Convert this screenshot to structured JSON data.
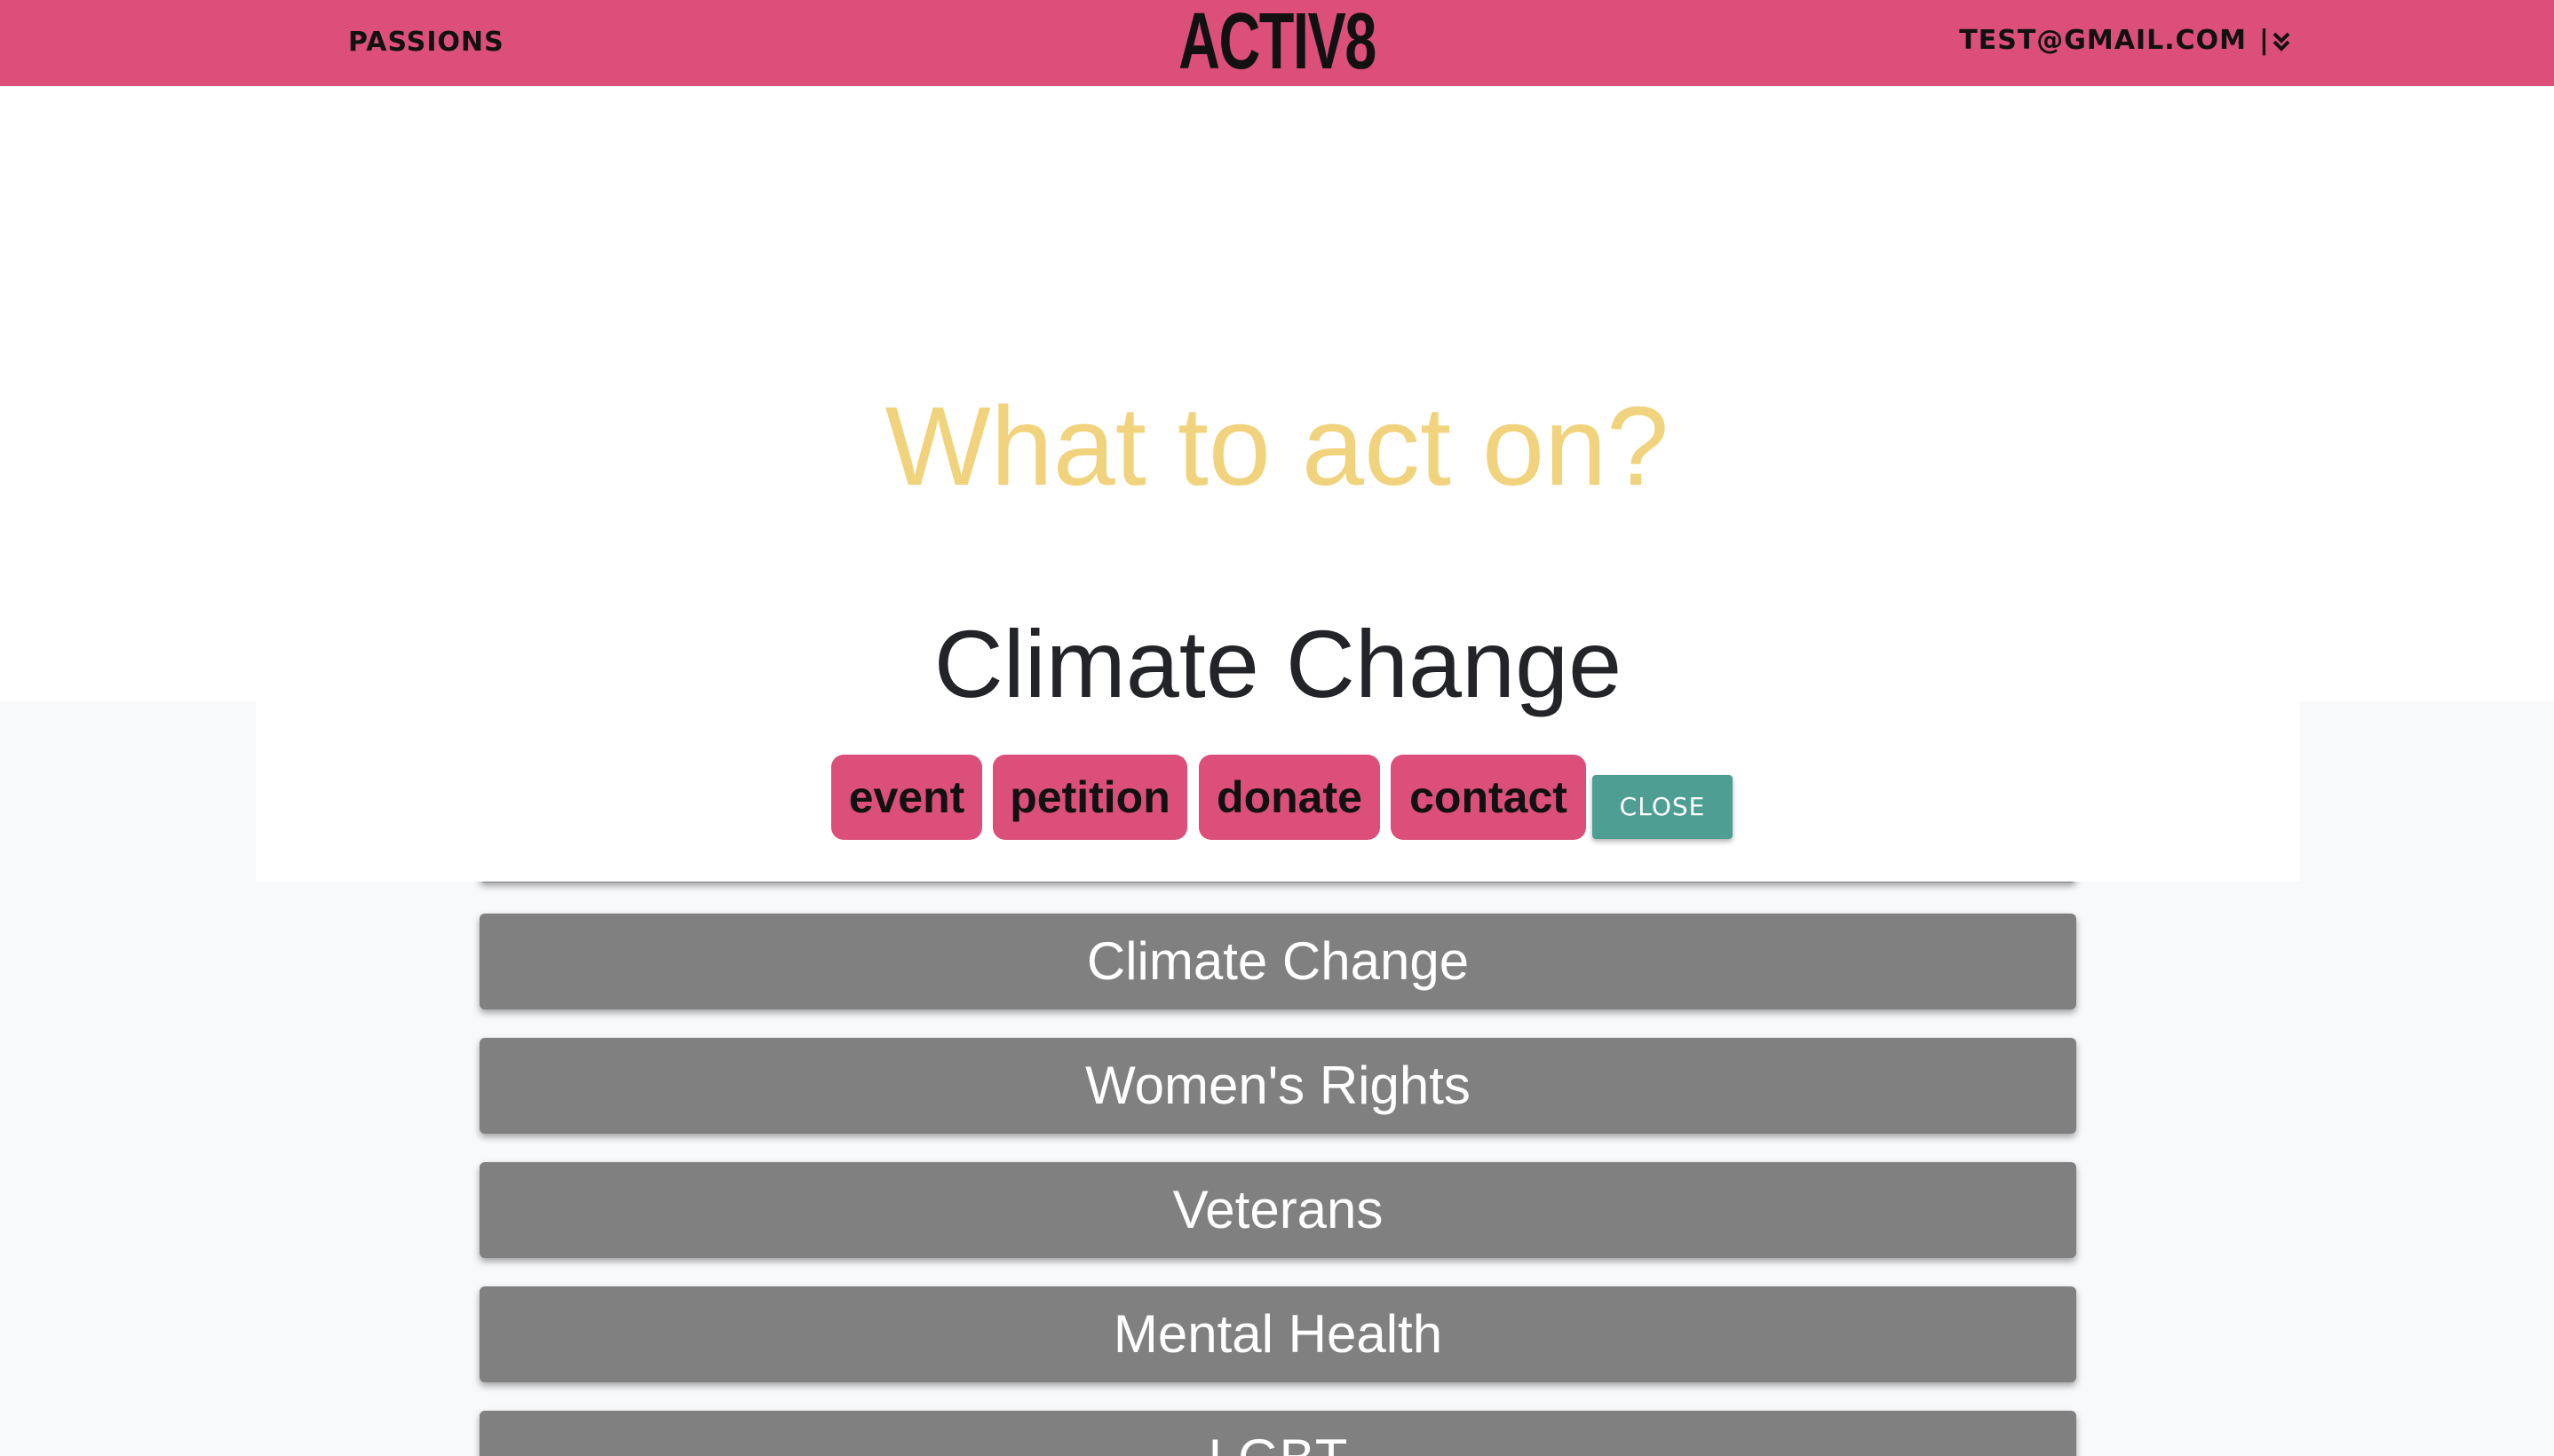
{
  "navbar": {
    "left_link": "PASSIONS",
    "logo": "ACTIV8",
    "user_email": "TEST@GMAIL.COM",
    "user_separator": "|",
    "dropdown_icon": "double-chevron-down-icon",
    "background_color": "#db4f7a"
  },
  "main": {
    "question": "What to act on?",
    "question_color": "#f0d37c"
  },
  "modal": {
    "title": "Climate Change",
    "actions": [
      "event",
      "petition",
      "donate",
      "contact"
    ],
    "close_label": "CLOSE",
    "chip_color": "#db4f7a",
    "close_color": "#4e9e93"
  },
  "causes": {
    "items": [
      "Climate Change",
      "Women's Rights",
      "Veterans",
      "Mental Health",
      "LGBT"
    ],
    "item_color": "#808080"
  }
}
